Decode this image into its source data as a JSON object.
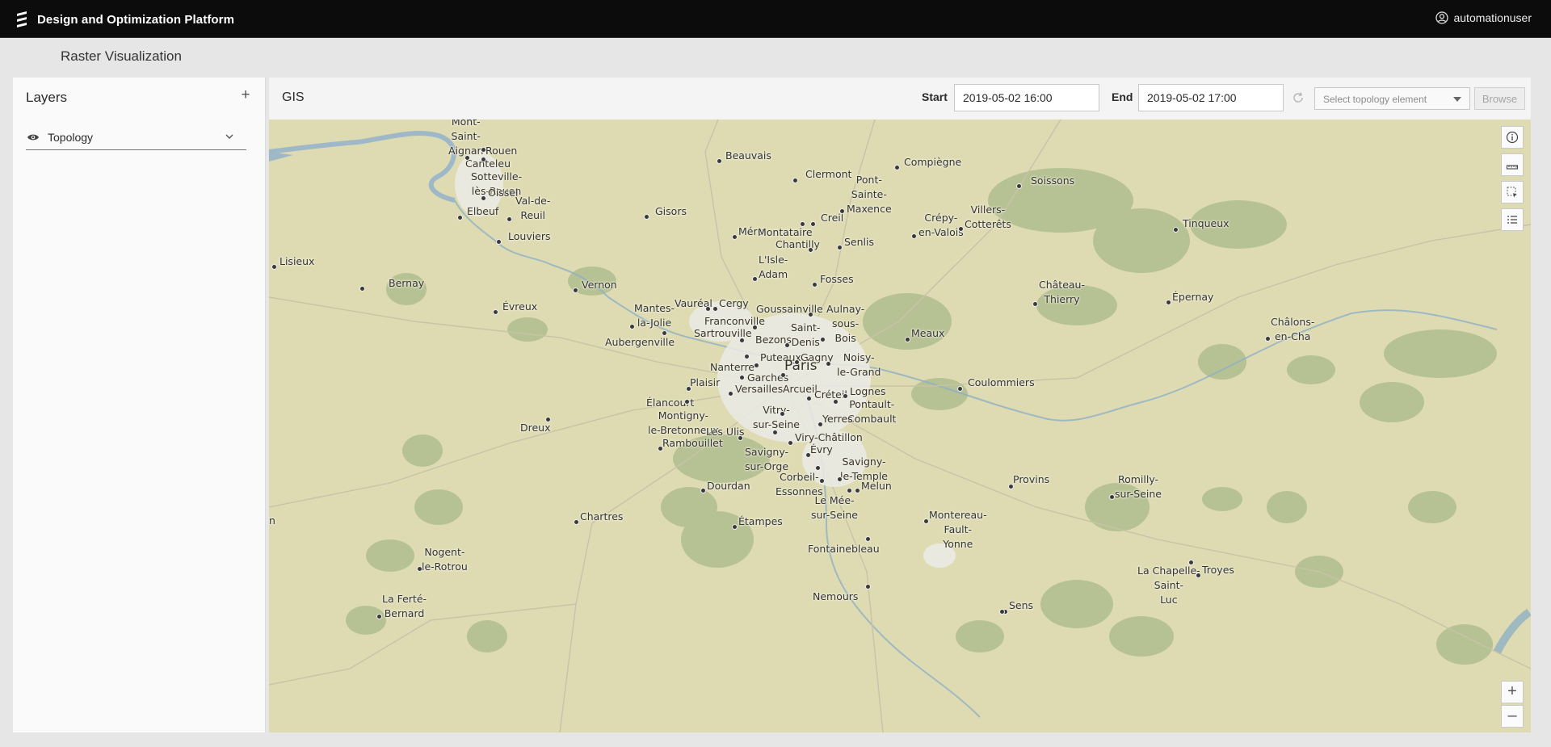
{
  "app": {
    "title": "Design and Optimization Platform",
    "user": "automationuser"
  },
  "page": {
    "title": "Raster Visualization"
  },
  "layers": {
    "title": "Layers",
    "add_label": "+",
    "items": [
      {
        "label": "Topology",
        "visible": true
      }
    ]
  },
  "gis": {
    "title": "GIS",
    "start_label": "Start",
    "start_value": "2019-05-02 16:00",
    "end_label": "End",
    "end_value": "2019-05-02 17:00",
    "topology_placeholder": "Select topology element",
    "browse_label": "Browse"
  },
  "map": {
    "zoom_in": "+",
    "zoom_out": "–",
    "tools": [
      "info-icon",
      "ruler-icon",
      "select-area-icon",
      "legend-list-icon"
    ],
    "cities": [
      {
        "name": "Mont-\nSaint-\nAignan"
      },
      {
        "name": "Rouen"
      },
      {
        "name": "Canteleu"
      },
      {
        "name": "Sotteville-\nlès-Rouen"
      },
      {
        "name": "Oissel"
      },
      {
        "name": "Val-de-\nReuil"
      },
      {
        "name": "Elbeuf"
      },
      {
        "name": "Louviers"
      },
      {
        "name": "Lisieux"
      },
      {
        "name": "Bernay"
      },
      {
        "name": "Évreux"
      },
      {
        "name": "Vernon"
      },
      {
        "name": "Gisors"
      },
      {
        "name": "Beauvais"
      },
      {
        "name": "Clermont"
      },
      {
        "name": "Pont-\nSainte-\nMaxence"
      },
      {
        "name": "Compiègne"
      },
      {
        "name": "Soissons"
      },
      {
        "name": "Méru"
      },
      {
        "name": "Montataire"
      },
      {
        "name": "Creil"
      },
      {
        "name": "Chantilly"
      },
      {
        "name": "Senlis"
      },
      {
        "name": "Crépy-\nen-Valois"
      },
      {
        "name": "Villers-\nCotterêts"
      },
      {
        "name": "Tinqueux"
      },
      {
        "name": "L'Isle-\nAdam"
      },
      {
        "name": "Fosses"
      },
      {
        "name": "Château-\nThierry"
      },
      {
        "name": "Épernay"
      },
      {
        "name": "Châlons-\nen-Cha"
      },
      {
        "name": "Mantes-\nla-Jolie"
      },
      {
        "name": "Vauréal"
      },
      {
        "name": "Cergy"
      },
      {
        "name": "Goussainville"
      },
      {
        "name": "Aulnay-\nsous-\nBois"
      },
      {
        "name": "Franconville"
      },
      {
        "name": "Sartrouville"
      },
      {
        "name": "Saint-\nDenis"
      },
      {
        "name": "Bezons"
      },
      {
        "name": "Aubergenville"
      },
      {
        "name": "Meaux"
      },
      {
        "name": "Puteaux"
      },
      {
        "name": "Gagny"
      },
      {
        "name": "Noisy-\nle-Grand"
      },
      {
        "name": "Nanterre"
      },
      {
        "name": "Paris"
      },
      {
        "name": "Garches"
      },
      {
        "name": "Plaisir"
      },
      {
        "name": "Versailles"
      },
      {
        "name": "Arcueil"
      },
      {
        "name": "Créteil"
      },
      {
        "name": "Lognes"
      },
      {
        "name": "Pontault-\nCombault"
      },
      {
        "name": "Coulommiers"
      },
      {
        "name": "Élancourt"
      },
      {
        "name": "Montigny-\nle-Bretonneux"
      },
      {
        "name": "Dreux"
      },
      {
        "name": "Vitry-\nsur-Seine"
      },
      {
        "name": "Yerres"
      },
      {
        "name": "Les Ulis"
      },
      {
        "name": "Rambouillet"
      },
      {
        "name": "Viry-Châtillon"
      },
      {
        "name": "Évry"
      },
      {
        "name": "Savigny-\nsur-Orge"
      },
      {
        "name": "Savigny-\nle-Temple"
      },
      {
        "name": "Corbeil-\nEssonnes"
      },
      {
        "name": "Melun"
      },
      {
        "name": "Dourdan"
      },
      {
        "name": "Provins"
      },
      {
        "name": "Romilly-\nsur-Seine"
      },
      {
        "name": "Le Mée-\nsur-Seine"
      },
      {
        "name": "Chartres"
      },
      {
        "name": "Étampes"
      },
      {
        "name": "Montereau-\nFault-\nYonne"
      },
      {
        "name": "Fontainebleau"
      },
      {
        "name": "Nogent-\nle-Rotrou"
      },
      {
        "name": "La Chapelle-\nSaint-\nLuc"
      },
      {
        "name": "Troyes"
      },
      {
        "name": "La Ferté-\nBernard"
      },
      {
        "name": "Nemours"
      },
      {
        "name": "Sens"
      },
      {
        "name": "n"
      }
    ]
  }
}
